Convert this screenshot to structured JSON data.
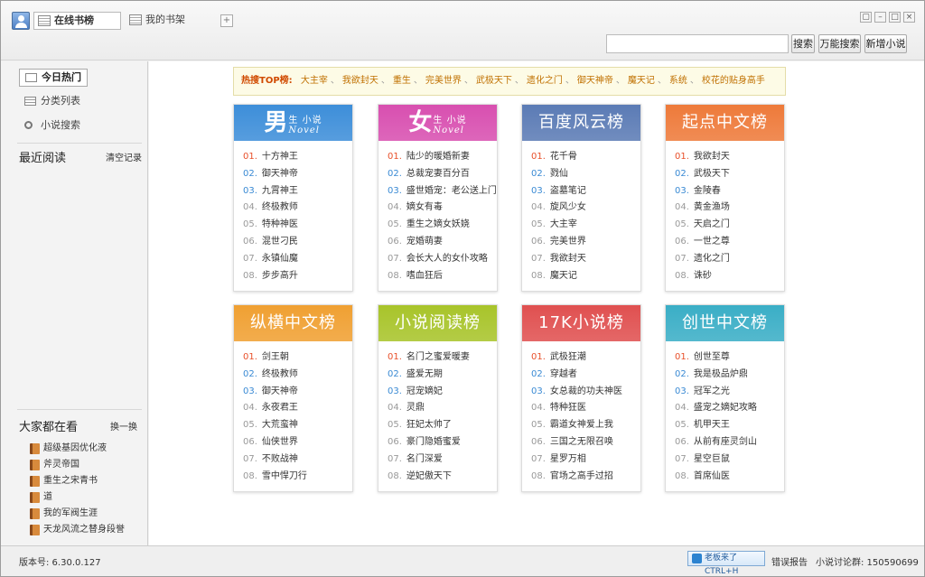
{
  "tabs": {
    "online": "在线书榜",
    "shelf": "我的书架",
    "add": "+"
  },
  "window_buttons": [
    "▢",
    "–",
    "□",
    "×"
  ],
  "toolbar": {
    "search_value": "",
    "search_btn": "搜索",
    "universal_btn": "万能搜索",
    "new_btn": "新增小说"
  },
  "sidebar": {
    "nav": [
      {
        "label": "今日热门"
      },
      {
        "label": "分类列表"
      },
      {
        "label": "小说搜索"
      }
    ],
    "recent_title": "最近阅读",
    "clear_label": "清空记录",
    "popular_title": "大家都在看",
    "refresh_label": "换一换",
    "popular": [
      "超级基因优化液",
      "斧灵帝国",
      "重生之宋青书",
      "道",
      "我的军阀生涯",
      "天龙风流之替身段誉"
    ]
  },
  "hot_search": {
    "label": "热搜TOP榜:",
    "items": [
      "大主宰",
      "我欲封天",
      "重生",
      "完美世界",
      "武极天下",
      "遗化之门",
      "御天神帝",
      "魔天记",
      "系统",
      "校花的贴身高手"
    ]
  },
  "cards": [
    {
      "title": "男",
      "sub1": "生 小说",
      "sub2": "Novel",
      "color": "#3d8ed9",
      "style": "big",
      "items": [
        "十方神王",
        "御天神帝",
        "九霄神王",
        "终极教师",
        "特种神医",
        "混世刁民",
        "永镇仙魔",
        "步步高升"
      ]
    },
    {
      "title": "女",
      "sub1": "生 小说",
      "sub2": "Novel",
      "color": "#d84fb0",
      "style": "big",
      "items": [
        "陆少的暖婚新妻",
        "总裁宠妻百分百",
        "盛世婚宠：老公送上门",
        "嫡女有毒",
        "重生之嫡女妖娆",
        "宠婚萌妻",
        "会长大人的女仆攻略",
        "嗜血狂后"
      ]
    },
    {
      "title": "百度风云榜",
      "color": "#5b7bb5",
      "style": "plain",
      "items": [
        "花千骨",
        "戮仙",
        "盗墓笔记",
        "旋风少女",
        "大主宰",
        "完美世界",
        "我欲封天",
        "魔天记"
      ]
    },
    {
      "title": "起点中文榜",
      "color": "#ee7a3a",
      "style": "plain",
      "items": [
        "我欲封天",
        "武极天下",
        "金陵春",
        "黄金渔场",
        "天启之门",
        "一世之尊",
        "遗化之门",
        "诛砂"
      ]
    },
    {
      "title": "纵横中文榜",
      "color": "#f0a032",
      "style": "plain",
      "items": [
        "剑王朝",
        "终极教师",
        "御天神帝",
        "永夜君王",
        "大荒蛮神",
        "仙侠世界",
        "不败战神",
        "雪中悍刀行"
      ]
    },
    {
      "title": "小说阅读榜",
      "color": "#a8c42a",
      "style": "plain",
      "items": [
        "名门之蜜爱暖妻",
        "盛爱无期",
        "冠宠嫡妃",
        "灵鼎",
        "狂妃太帅了",
        "豪门隐婚蜜爱",
        "名门深爱",
        "逆妃傲天下"
      ]
    },
    {
      "title": "17K小说榜",
      "color": "#e05050",
      "style": "plain",
      "items": [
        "武极狂潮",
        "穿越者",
        "女总裁的功夫神医",
        "特种狂医",
        "霸道女神爱上我",
        "三国之无限召唤",
        "星罗万相",
        "官场之高手过招"
      ]
    },
    {
      "title": "创世中文榜",
      "color": "#3aaec6",
      "style": "plain",
      "items": [
        "创世至尊",
        "我是极品炉鼎",
        "冠军之光",
        "盛宠之嫡妃攻略",
        "机甲天王",
        "从前有座灵剑山",
        "星空巨鼠",
        "首席仙医"
      ]
    }
  ],
  "status": {
    "version": "版本号: 6.30.0.127",
    "boss_btn": "老板来了CTRL+H",
    "error": "错误报告",
    "qq": "小说讨论群: 150590699"
  }
}
